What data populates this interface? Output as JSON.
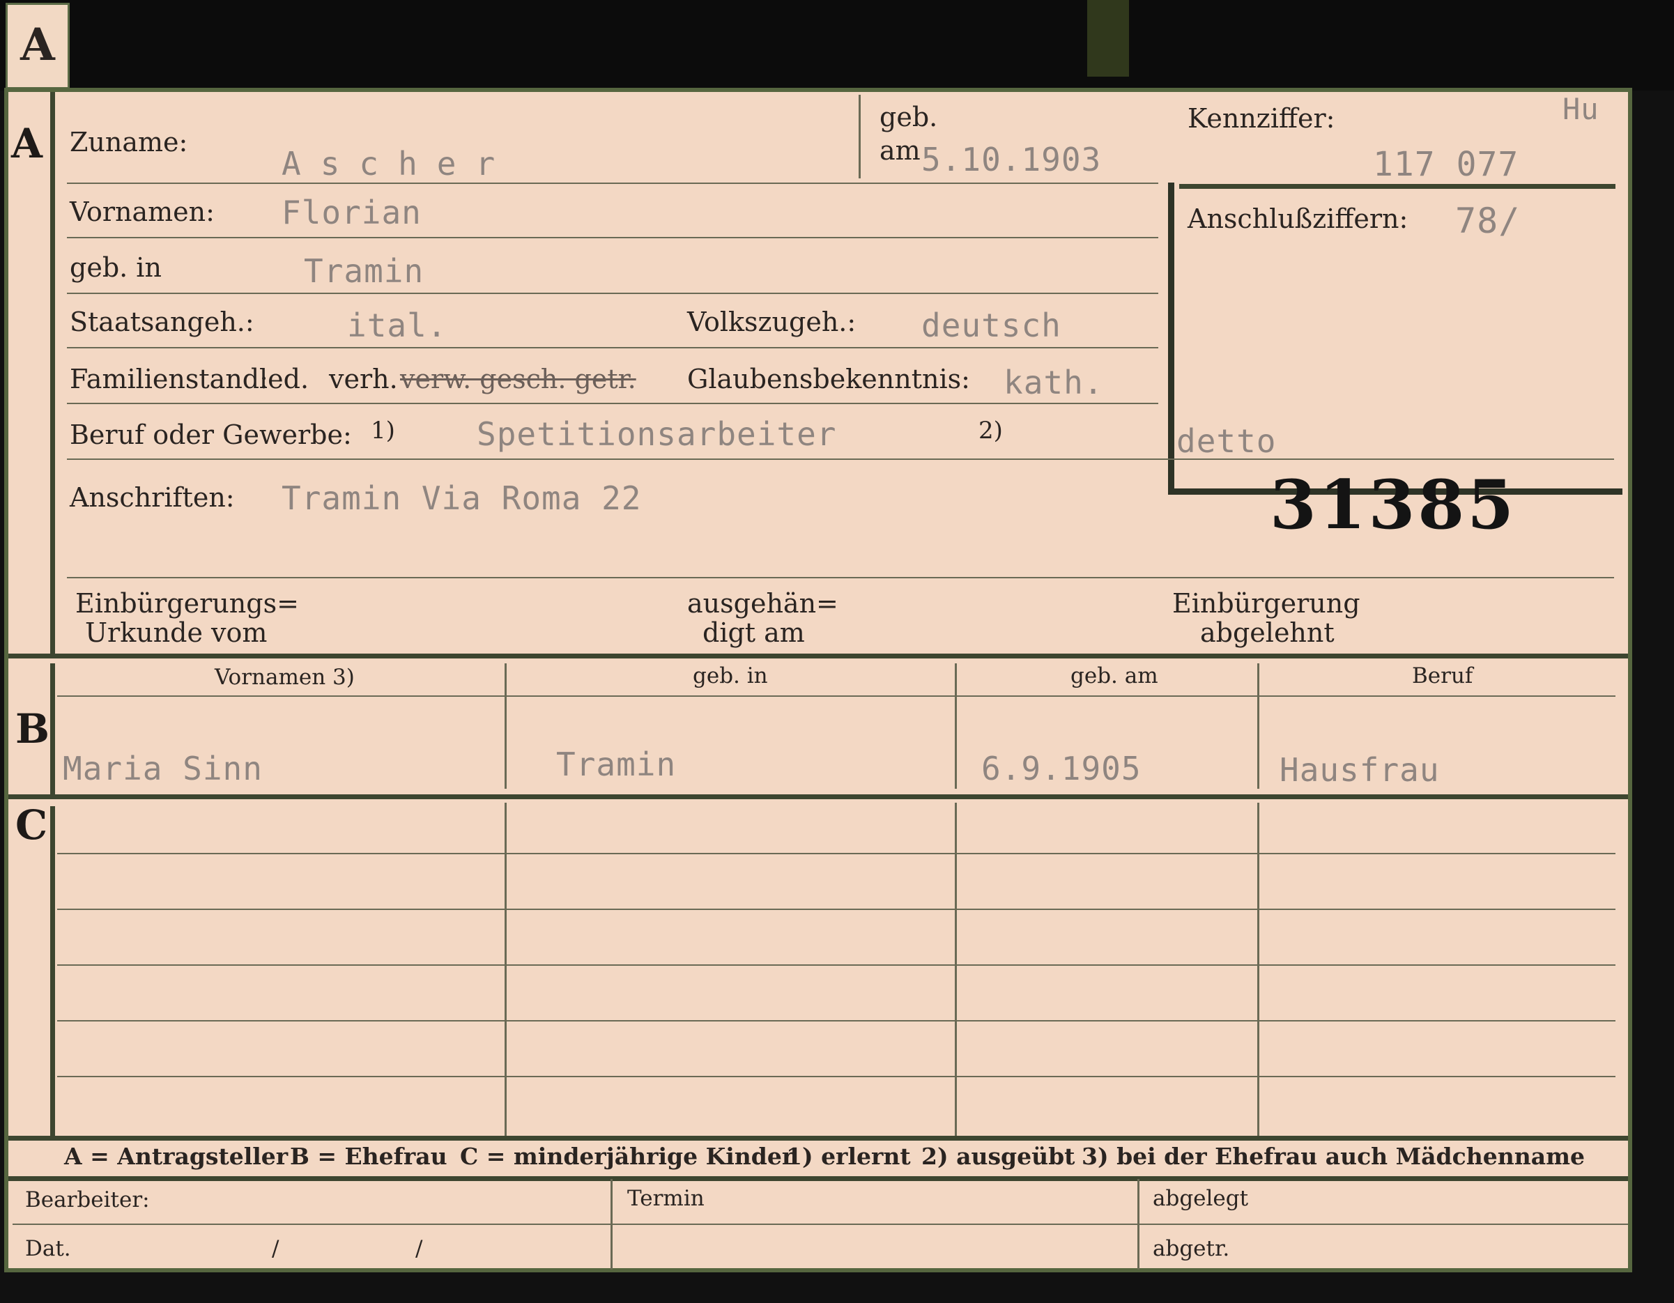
{
  "tab": {
    "letter": "A"
  },
  "sections": {
    "a": "A",
    "b": "B",
    "c": "C"
  },
  "header": {
    "surname_label": "Zuname:",
    "surname_value": "Ascher",
    "birth_label_1": "geb.",
    "birth_label_2": "am",
    "birth_date": "5.10.1903",
    "kenn_label": "Kennziffer:",
    "kenn_value": "117 077",
    "kenn_initials": "Hu",
    "anschluss_label": "Anschlußziffern:",
    "anschluss_value": "78/",
    "first_names_label": "Vornamen:",
    "first_names_value": "Florian",
    "birthplace_label": "geb. in",
    "birthplace_value": "Tramin",
    "citizenship_label": "Staatsangeh.:",
    "citizenship_value": "ital.",
    "ethnicity_label": "Volkszugeh.:",
    "ethnicity_value": "deutsch",
    "family_label": "Familienstand:",
    "family_led": "led.",
    "family_verh": "verh.",
    "family_struck": "verw. gesch. getr.",
    "religion_label": "Glaubensbekenntnis:",
    "religion_value": "kath.",
    "profession_label": "Beruf oder Gewerbe:",
    "profession_note1": "1)",
    "profession_value": "Spetitionsarbeiter",
    "profession_note2": "2)",
    "profession_value2": "detto",
    "address_label": "Anschriften:",
    "address_value": "Tramin Via Roma 22",
    "stamp_number": "31385",
    "naturalization_label_1": "Einbürgerungs=",
    "naturalization_label_2": "Urkunde vom",
    "handed_label_1": "ausgehän=",
    "handed_label_2": "digt am",
    "rejected_label_1": "Einbürgerung",
    "rejected_label_2": "abgelehnt"
  },
  "table": {
    "columns": [
      "Vornamen 3)",
      "geb. in",
      "geb. am",
      "Beruf"
    ],
    "b_row": [
      "Maria Sinn",
      "Tramin",
      "6.9.1905",
      "Hausfrau"
    ]
  },
  "legend": {
    "a": "A = Antragsteller",
    "b": "B = Ehefrau",
    "c": "C = minderjährige Kinder",
    "n1": "1) erlernt",
    "n2": "2) ausgeübt",
    "n3": "3) bei der Ehefrau auch Mädchenname"
  },
  "footer": {
    "worker_label": "Bearbeiter:",
    "date_label": "Dat.",
    "slash": "/",
    "termin_label": "Termin",
    "filed_label": "abgelegt",
    "removed_label": "abgetr."
  }
}
